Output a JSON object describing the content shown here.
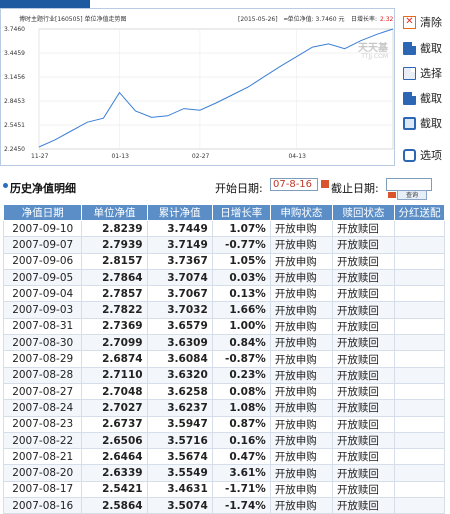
{
  "chart": {
    "title_left": "博时主题行业[160505] 单位净值走势图",
    "date": "[2015-05-26]",
    "legend_label": "━单位净值: 3.7460 元",
    "legend_growth_label": "日增长率:",
    "legend_growth_value": "2.32",
    "watermark": "天天基",
    "watermark_sub": "TTJJ.COM",
    "y_tick_labels": [
      "3.7460",
      "3.4459",
      "3.1456",
      "2.8453",
      "2.5451",
      "2.2450"
    ],
    "x_tick_labels": [
      "11-27",
      "01-13",
      "02-27",
      "04-13"
    ],
    "chart_data": {
      "type": "line",
      "title": "博时主题行业[160505] 单位净值走势图",
      "x": [
        "11-27",
        "12-05",
        "12-15",
        "12-25",
        "01-05",
        "01-13",
        "01-20",
        "01-28",
        "02-05",
        "02-13",
        "02-27",
        "03-06",
        "03-13",
        "03-20",
        "03-27",
        "04-03",
        "04-13",
        "04-20",
        "04-27",
        "05-05",
        "05-12",
        "05-19",
        "05-26"
      ],
      "values": [
        2.27,
        2.36,
        2.47,
        2.58,
        2.63,
        2.95,
        2.72,
        2.64,
        2.66,
        2.75,
        2.73,
        2.82,
        2.92,
        3.02,
        3.15,
        3.28,
        3.4,
        3.52,
        3.56,
        3.5,
        3.6,
        3.68,
        3.746
      ],
      "ylim": [
        2.245,
        3.746
      ],
      "grid": true
    }
  },
  "menu": {
    "items": [
      {
        "label": "清除",
        "icon": "clear-icon"
      },
      {
        "label": "截取",
        "icon": "doc-icon"
      },
      {
        "label": "选择",
        "icon": "doc-icon"
      },
      {
        "label": "截取",
        "icon": "doc-icon"
      },
      {
        "label": "截取",
        "icon": "box-icon"
      },
      {
        "label": "选项",
        "icon": "options-icon"
      }
    ]
  },
  "filter": {
    "section_title": "历史净值明细",
    "start_label": "开始日期:",
    "start_value": "07-8-16",
    "end_label": "截止日期:",
    "end_value": "",
    "query_label": "查询"
  },
  "table": {
    "headers": [
      "净值日期",
      "单位净值",
      "累计净值",
      "日增长率",
      "申购状态",
      "赎回状态",
      "分红送配"
    ],
    "rows": [
      [
        "2007-09-10",
        "2.8239",
        "3.7449",
        "1.07%",
        "开放申购",
        "开放赎回",
        ""
      ],
      [
        "2007-09-07",
        "2.7939",
        "3.7149",
        "-0.77%",
        "开放申购",
        "开放赎回",
        ""
      ],
      [
        "2007-09-06",
        "2.8157",
        "3.7367",
        "1.05%",
        "开放申购",
        "开放赎回",
        ""
      ],
      [
        "2007-09-05",
        "2.7864",
        "3.7074",
        "0.03%",
        "开放申购",
        "开放赎回",
        ""
      ],
      [
        "2007-09-04",
        "2.7857",
        "3.7067",
        "0.13%",
        "开放申购",
        "开放赎回",
        ""
      ],
      [
        "2007-09-03",
        "2.7822",
        "3.7032",
        "1.66%",
        "开放申购",
        "开放赎回",
        ""
      ],
      [
        "2007-08-31",
        "2.7369",
        "3.6579",
        "1.00%",
        "开放申购",
        "开放赎回",
        ""
      ],
      [
        "2007-08-30",
        "2.7099",
        "3.6309",
        "0.84%",
        "开放申购",
        "开放赎回",
        ""
      ],
      [
        "2007-08-29",
        "2.6874",
        "3.6084",
        "-0.87%",
        "开放申购",
        "开放赎回",
        ""
      ],
      [
        "2007-08-28",
        "2.7110",
        "3.6320",
        "0.23%",
        "开放申购",
        "开放赎回",
        ""
      ],
      [
        "2007-08-27",
        "2.7048",
        "3.6258",
        "0.08%",
        "开放申购",
        "开放赎回",
        ""
      ],
      [
        "2007-08-24",
        "2.7027",
        "3.6237",
        "1.08%",
        "开放申购",
        "开放赎回",
        ""
      ],
      [
        "2007-08-23",
        "2.6737",
        "3.5947",
        "0.87%",
        "开放申购",
        "开放赎回",
        ""
      ],
      [
        "2007-08-22",
        "2.6506",
        "3.5716",
        "0.16%",
        "开放申购",
        "开放赎回",
        ""
      ],
      [
        "2007-08-21",
        "2.6464",
        "3.5674",
        "0.47%",
        "开放申购",
        "开放赎回",
        ""
      ],
      [
        "2007-08-20",
        "2.6339",
        "3.5549",
        "3.61%",
        "开放申购",
        "开放赎回",
        ""
      ],
      [
        "2007-08-17",
        "2.5421",
        "3.4631",
        "-1.71%",
        "开放申购",
        "开放赎回",
        ""
      ],
      [
        "2007-08-16",
        "2.5864",
        "3.5074",
        "-1.74%",
        "开放申购",
        "开放赎回",
        ""
      ]
    ]
  },
  "colors": {
    "accent": "#5b8ec7",
    "line": "#3a7fd5",
    "up": "#e3161b",
    "down": "#0e8a2c"
  }
}
